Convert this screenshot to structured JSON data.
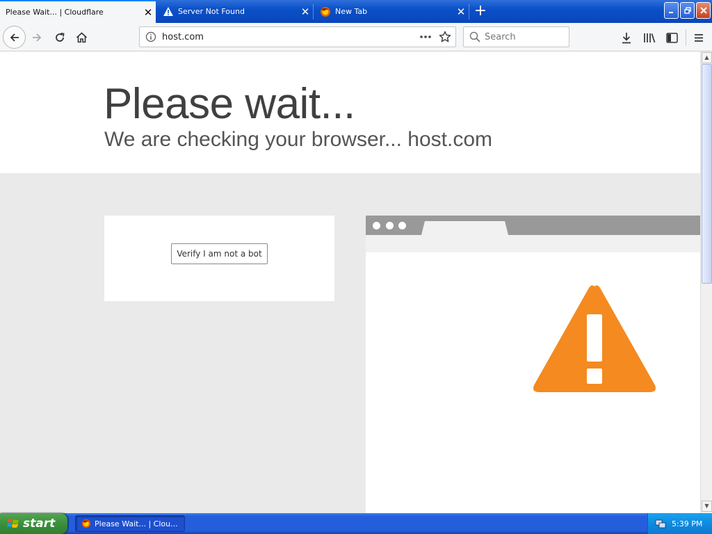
{
  "browser": {
    "tabs": [
      {
        "title": "Please Wait... | Cloudflare",
        "icon": "none",
        "active": true
      },
      {
        "title": "Server Not Found",
        "icon": "warning-icon",
        "active": false
      },
      {
        "title": "New Tab",
        "icon": "firefox-icon",
        "active": false
      }
    ],
    "url": "host.com",
    "search_placeholder": "Search"
  },
  "page": {
    "title": "Please wait...",
    "subtitle": "We are checking your browser... host.com",
    "verify_button": "Verify I am not a bot"
  },
  "taskbar": {
    "start_label": "start",
    "task_item": "Please Wait... | Clou...",
    "clock": "5:39 PM"
  },
  "colors": {
    "warning_orange": "#f48a20",
    "page_background": "#eaeaea",
    "taskbar_blue": "#245edb"
  }
}
